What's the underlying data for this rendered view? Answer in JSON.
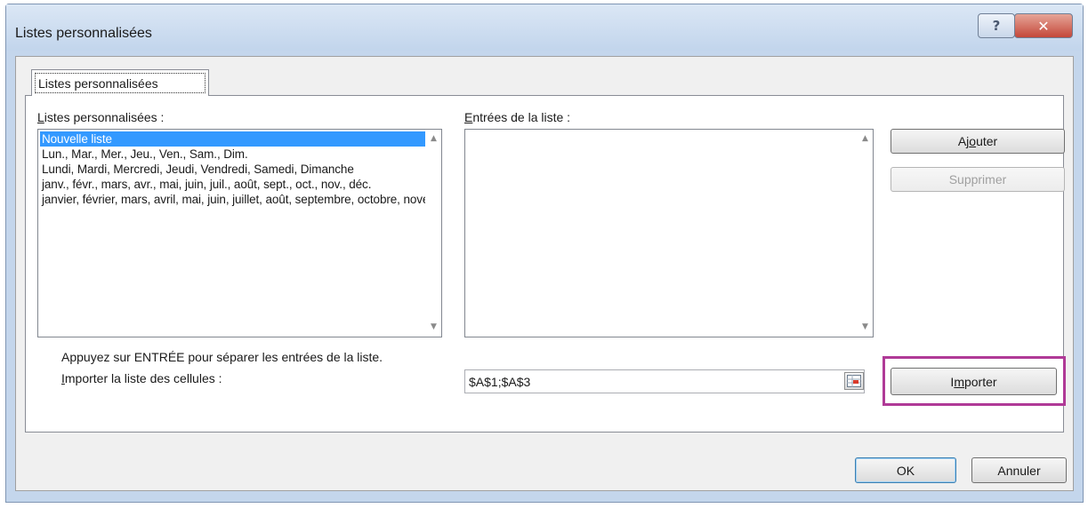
{
  "window": {
    "title": "Listes personnalisées",
    "help_label": "?",
    "close_label": "✕"
  },
  "tab": {
    "label": "Listes personnalisées"
  },
  "left_panel": {
    "label_hotkey": "L",
    "label_rest": "istes personnalisées :",
    "items": [
      "Nouvelle liste",
      "Lun., Mar., Mer., Jeu., Ven., Sam., Dim.",
      "Lundi, Mardi, Mercredi, Jeudi, Vendredi, Samedi, Dimanche",
      "janv., févr., mars, avr., mai, juin, juil., août, sept., oct., nov., déc.",
      "janvier, février, mars, avril, mai, juin, juillet, août, septembre, octobre, novembre, décembre"
    ],
    "selected_index": 0
  },
  "right_panel": {
    "label_hotkey": "E",
    "label_rest": "ntrées de la liste :",
    "entries_value": ""
  },
  "buttons": {
    "add_pre": "Aj",
    "add_hotkey": "o",
    "add_post": "uter",
    "delete": "Supprimer",
    "import_pre": "I",
    "import_hotkey": "m",
    "import_post": "porter",
    "ok": "OK",
    "cancel": "Annuler"
  },
  "hint": "Appuyez sur ENTRÉE pour séparer les entrées de la liste.",
  "import_field": {
    "label_hotkey": "I",
    "label_rest": "mporter la liste des cellules :",
    "value": "$A$1;$A$3"
  },
  "colors": {
    "selection": "#3399ff",
    "highlight_frame": "#b03a97",
    "close_button": "#c4483a"
  }
}
